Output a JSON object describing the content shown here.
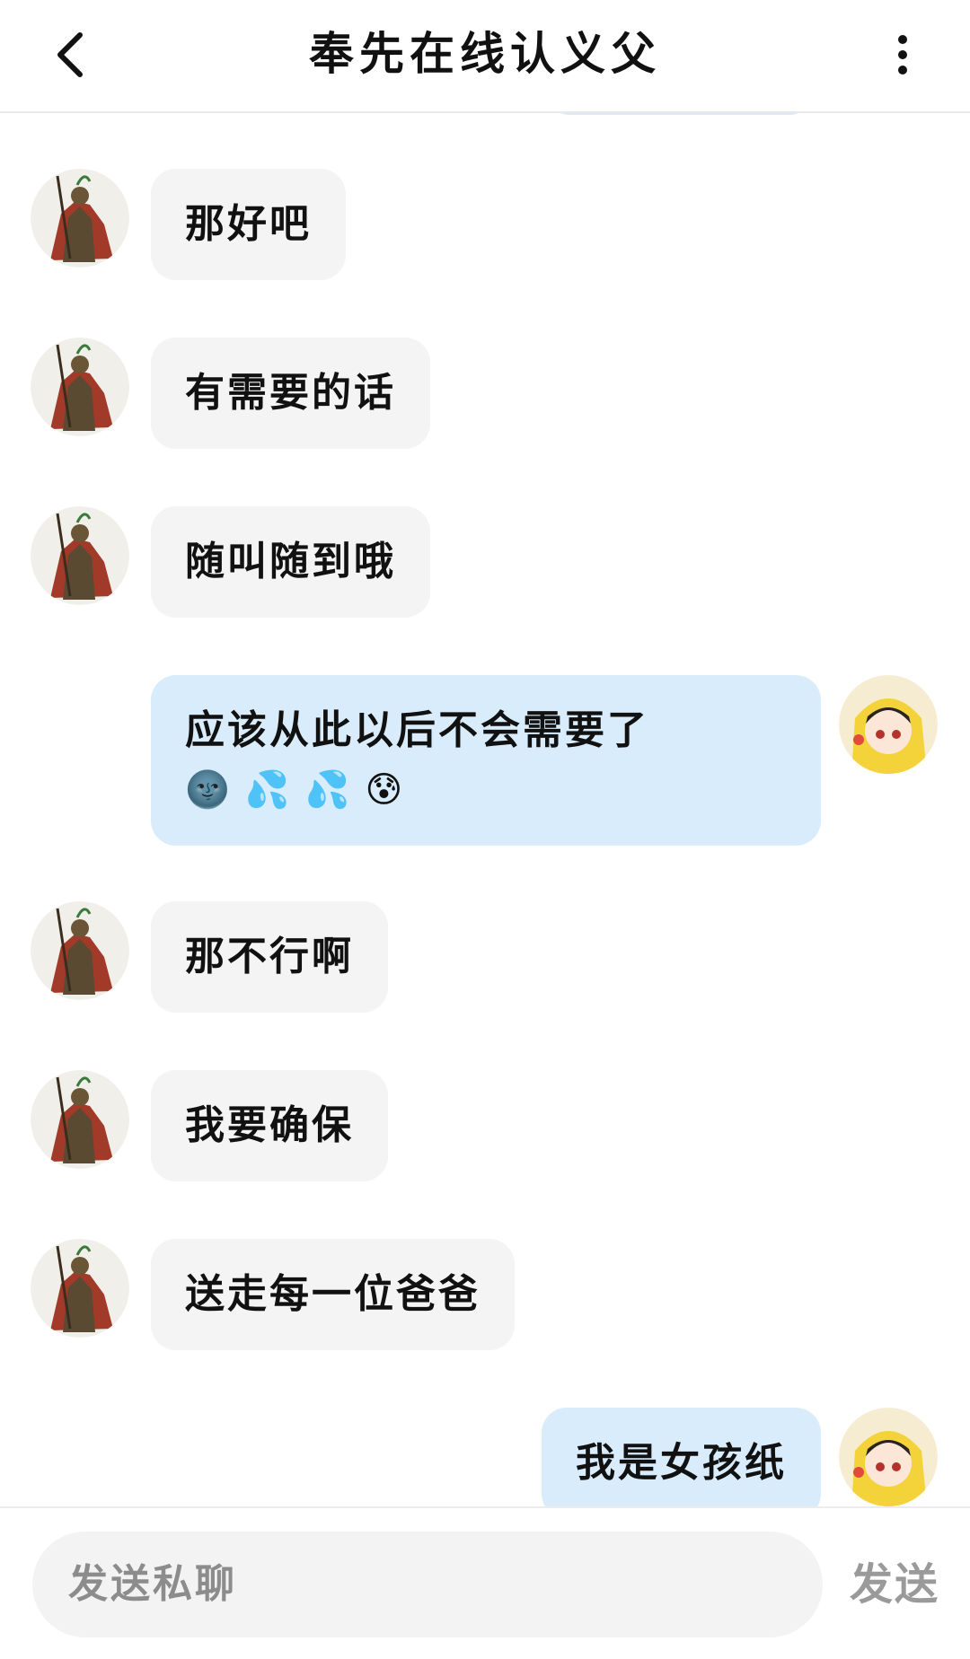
{
  "header": {
    "title": "奉先在线认义父",
    "back_icon": "chevron-left-icon",
    "more_icon": "more-vertical-icon"
  },
  "messages": [
    {
      "side": "in",
      "text": "那好吧"
    },
    {
      "side": "in",
      "text": "有需要的话"
    },
    {
      "side": "in",
      "text": "随叫随到哦"
    },
    {
      "side": "out",
      "text": "应该从此以后不会需要了",
      "emojis": [
        "🌚",
        "💦",
        "💦",
        "😰"
      ]
    },
    {
      "side": "in",
      "text": "那不行啊"
    },
    {
      "side": "in",
      "text": "我要确保"
    },
    {
      "side": "in",
      "text": "送走每一位爸爸"
    },
    {
      "side": "out",
      "text": "我是女孩纸"
    }
  ],
  "composer": {
    "placeholder": "发送私聊",
    "send_label": "发送"
  },
  "colors": {
    "incoming_bubble": "#f4f4f4",
    "outgoing_bubble": "#d8ecfb",
    "placeholder_text": "#8c8c8c"
  }
}
